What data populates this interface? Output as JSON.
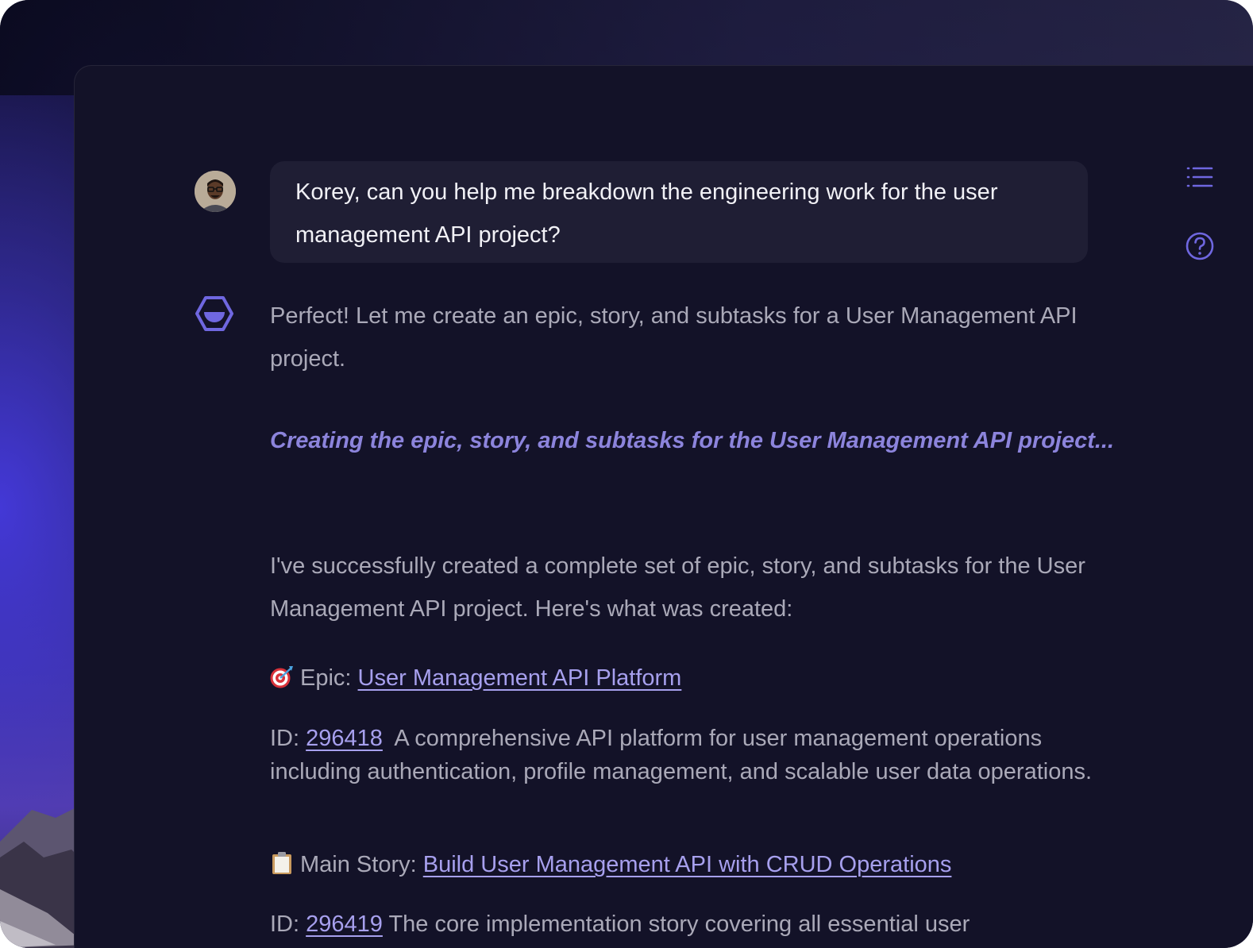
{
  "conversation": {
    "user_message": "Korey, can you help me breakdown the engineering work for the user management API project?",
    "assistant": {
      "intro": "Perfect! Let me create an epic, story, and subtasks for a User Management API project.",
      "status": "Creating the epic, story, and subtasks for the User Management API project...",
      "summary": "I've successfully created a complete set of epic, story, and subtasks for the User Management API project. Here's what was created:",
      "epic": {
        "icon": "target-icon",
        "prefix": "Epic:",
        "link": "User Management API Platform",
        "id_prefix": "ID:",
        "id": "296418",
        "description": "A comprehensive API platform for user management operations including authentication, profile management, and scalable user data operations."
      },
      "story": {
        "icon": "clipboard-icon",
        "prefix": "Main Story:",
        "link": "Build User Management API with CRUD Operations",
        "id_prefix": "ID:",
        "id": "296419",
        "description": "The core implementation story covering all essential user"
      }
    }
  },
  "sidebar": {
    "buttons": [
      {
        "icon": "list-icon"
      },
      {
        "icon": "help-circle-icon"
      }
    ]
  },
  "colors": {
    "accent": "#6f67e0",
    "link": "#a7a0ee",
    "status": "#8c84dc",
    "panel": "#131228",
    "bubble": "#1f1e34"
  }
}
